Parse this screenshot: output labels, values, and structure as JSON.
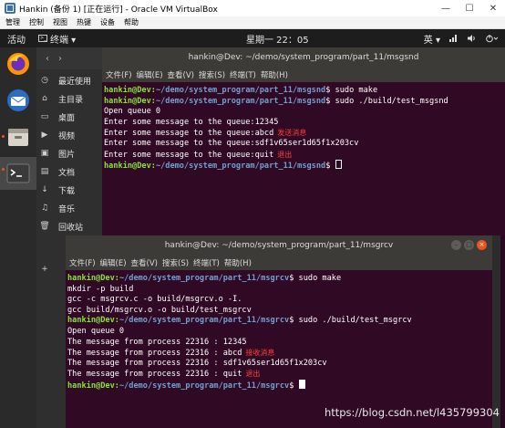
{
  "vbox": {
    "title": "Hankin (备份 1) [正在运行] - Oracle VM VirtualBox",
    "menu": [
      "管理",
      "控制",
      "视图",
      "热键",
      "设备",
      "帮助"
    ],
    "min": "—",
    "max": "☐",
    "close": "✕"
  },
  "gnome": {
    "activities": "活动",
    "app_name": "终端 ▾",
    "clock": "星期一 22：05",
    "input_method": "英 ▾",
    "tray_icons": [
      "network-icon",
      "volume-icon",
      "power-icon"
    ]
  },
  "files": {
    "nav": [
      "‹",
      "›"
    ],
    "items": [
      {
        "icon": "recent-icon",
        "glyph": "◷",
        "label": "最近使用"
      },
      {
        "icon": "home-icon",
        "glyph": "⌂",
        "label": "主目录"
      },
      {
        "icon": "desktop-icon",
        "glyph": "▭",
        "label": "桌面"
      },
      {
        "icon": "videos-icon",
        "glyph": "▶",
        "label": "视频"
      },
      {
        "icon": "pictures-icon",
        "glyph": "▣",
        "label": "图片"
      },
      {
        "icon": "documents-icon",
        "glyph": "▤",
        "label": "文档"
      },
      {
        "icon": "downloads-icon",
        "glyph": "↓",
        "label": "下载"
      },
      {
        "icon": "music-icon",
        "glyph": "♫",
        "label": "音乐"
      },
      {
        "icon": "trash-icon",
        "glyph": "🗑",
        "label": "回收站"
      },
      {
        "icon": "add-icon",
        "glyph": "+",
        "label": ""
      }
    ]
  },
  "term1": {
    "title": "hankin@Dev: ~/demo/system_program/part_11/msgsnd",
    "menu": [
      "文件(F)",
      "编辑(E)",
      "查看(V)",
      "搜索(S)",
      "终端(T)",
      "帮助(H)"
    ],
    "lines": [
      {
        "user": "hankin@Dev",
        "path": "~/demo/system_program/part_11/msgsnd",
        "cmd": "$ sudo make"
      },
      {
        "user": "hankin@Dev",
        "path": "~/demo/system_program/part_11/msgsnd",
        "cmd": "$ sudo ./build/test_msgsnd"
      },
      {
        "text": "Open queue 0"
      },
      {
        "text": "Enter some message to the queue:12345"
      },
      {
        "text": "Enter some message to the queue:abcd",
        "note": "发送消息"
      },
      {
        "text": "Enter some message to the queue:sdf1v65ser1d65f1x203cv"
      },
      {
        "text": "Enter some message to the queue:quit",
        "note": "退出"
      },
      {
        "user": "hankin@Dev",
        "path": "~/demo/system_program/part_11/msgsnd",
        "cmd": "$ ",
        "cursor": "hollow"
      }
    ]
  },
  "term2": {
    "title": "hankin@Dev: ~/demo/system_program/part_11/msgrcv",
    "menu": [
      "文件(F)",
      "编辑(E)",
      "查看(V)",
      "搜索(S)",
      "终端(T)",
      "帮助(H)"
    ],
    "lines": [
      {
        "user": "hankin@Dev",
        "path": "~/demo/system_program/part_11/msgrcv",
        "cmd": "$ sudo make"
      },
      {
        "text": "mkdir -p build"
      },
      {
        "text": "gcc -c msgrcv.c -o build/msgrcv.o -I."
      },
      {
        "text": "gcc build/msgrcv.o -o build/test_msgrcv"
      },
      {
        "user": "hankin@Dev",
        "path": "~/demo/system_program/part_11/msgrcv",
        "cmd": "$ sudo ./build/test_msgrcv"
      },
      {
        "text": "Open queue 0"
      },
      {
        "text": "The message from process 22316 : 12345"
      },
      {
        "text": "The message from process 22316 : abcd",
        "note": "接收消息"
      },
      {
        "text": "The message from process 22316 : sdf1v65ser1d65f1x203cv"
      },
      {
        "text": "The message from process 22316 : quit",
        "note": "退出"
      },
      {
        "user": "hankin@Dev",
        "path": "~/demo/system_program/part_11/msgrcv",
        "cmd": "$ ",
        "cursor": "solid"
      }
    ]
  },
  "watermark": "https://blog.csdn.net/l435799304",
  "colors": {
    "terminal_bg": "#300a24",
    "prompt_user": "#8ae234",
    "prompt_path": "#729fcf",
    "annotation": "#ff3b3b",
    "ubuntu_orange": "#e95420"
  }
}
